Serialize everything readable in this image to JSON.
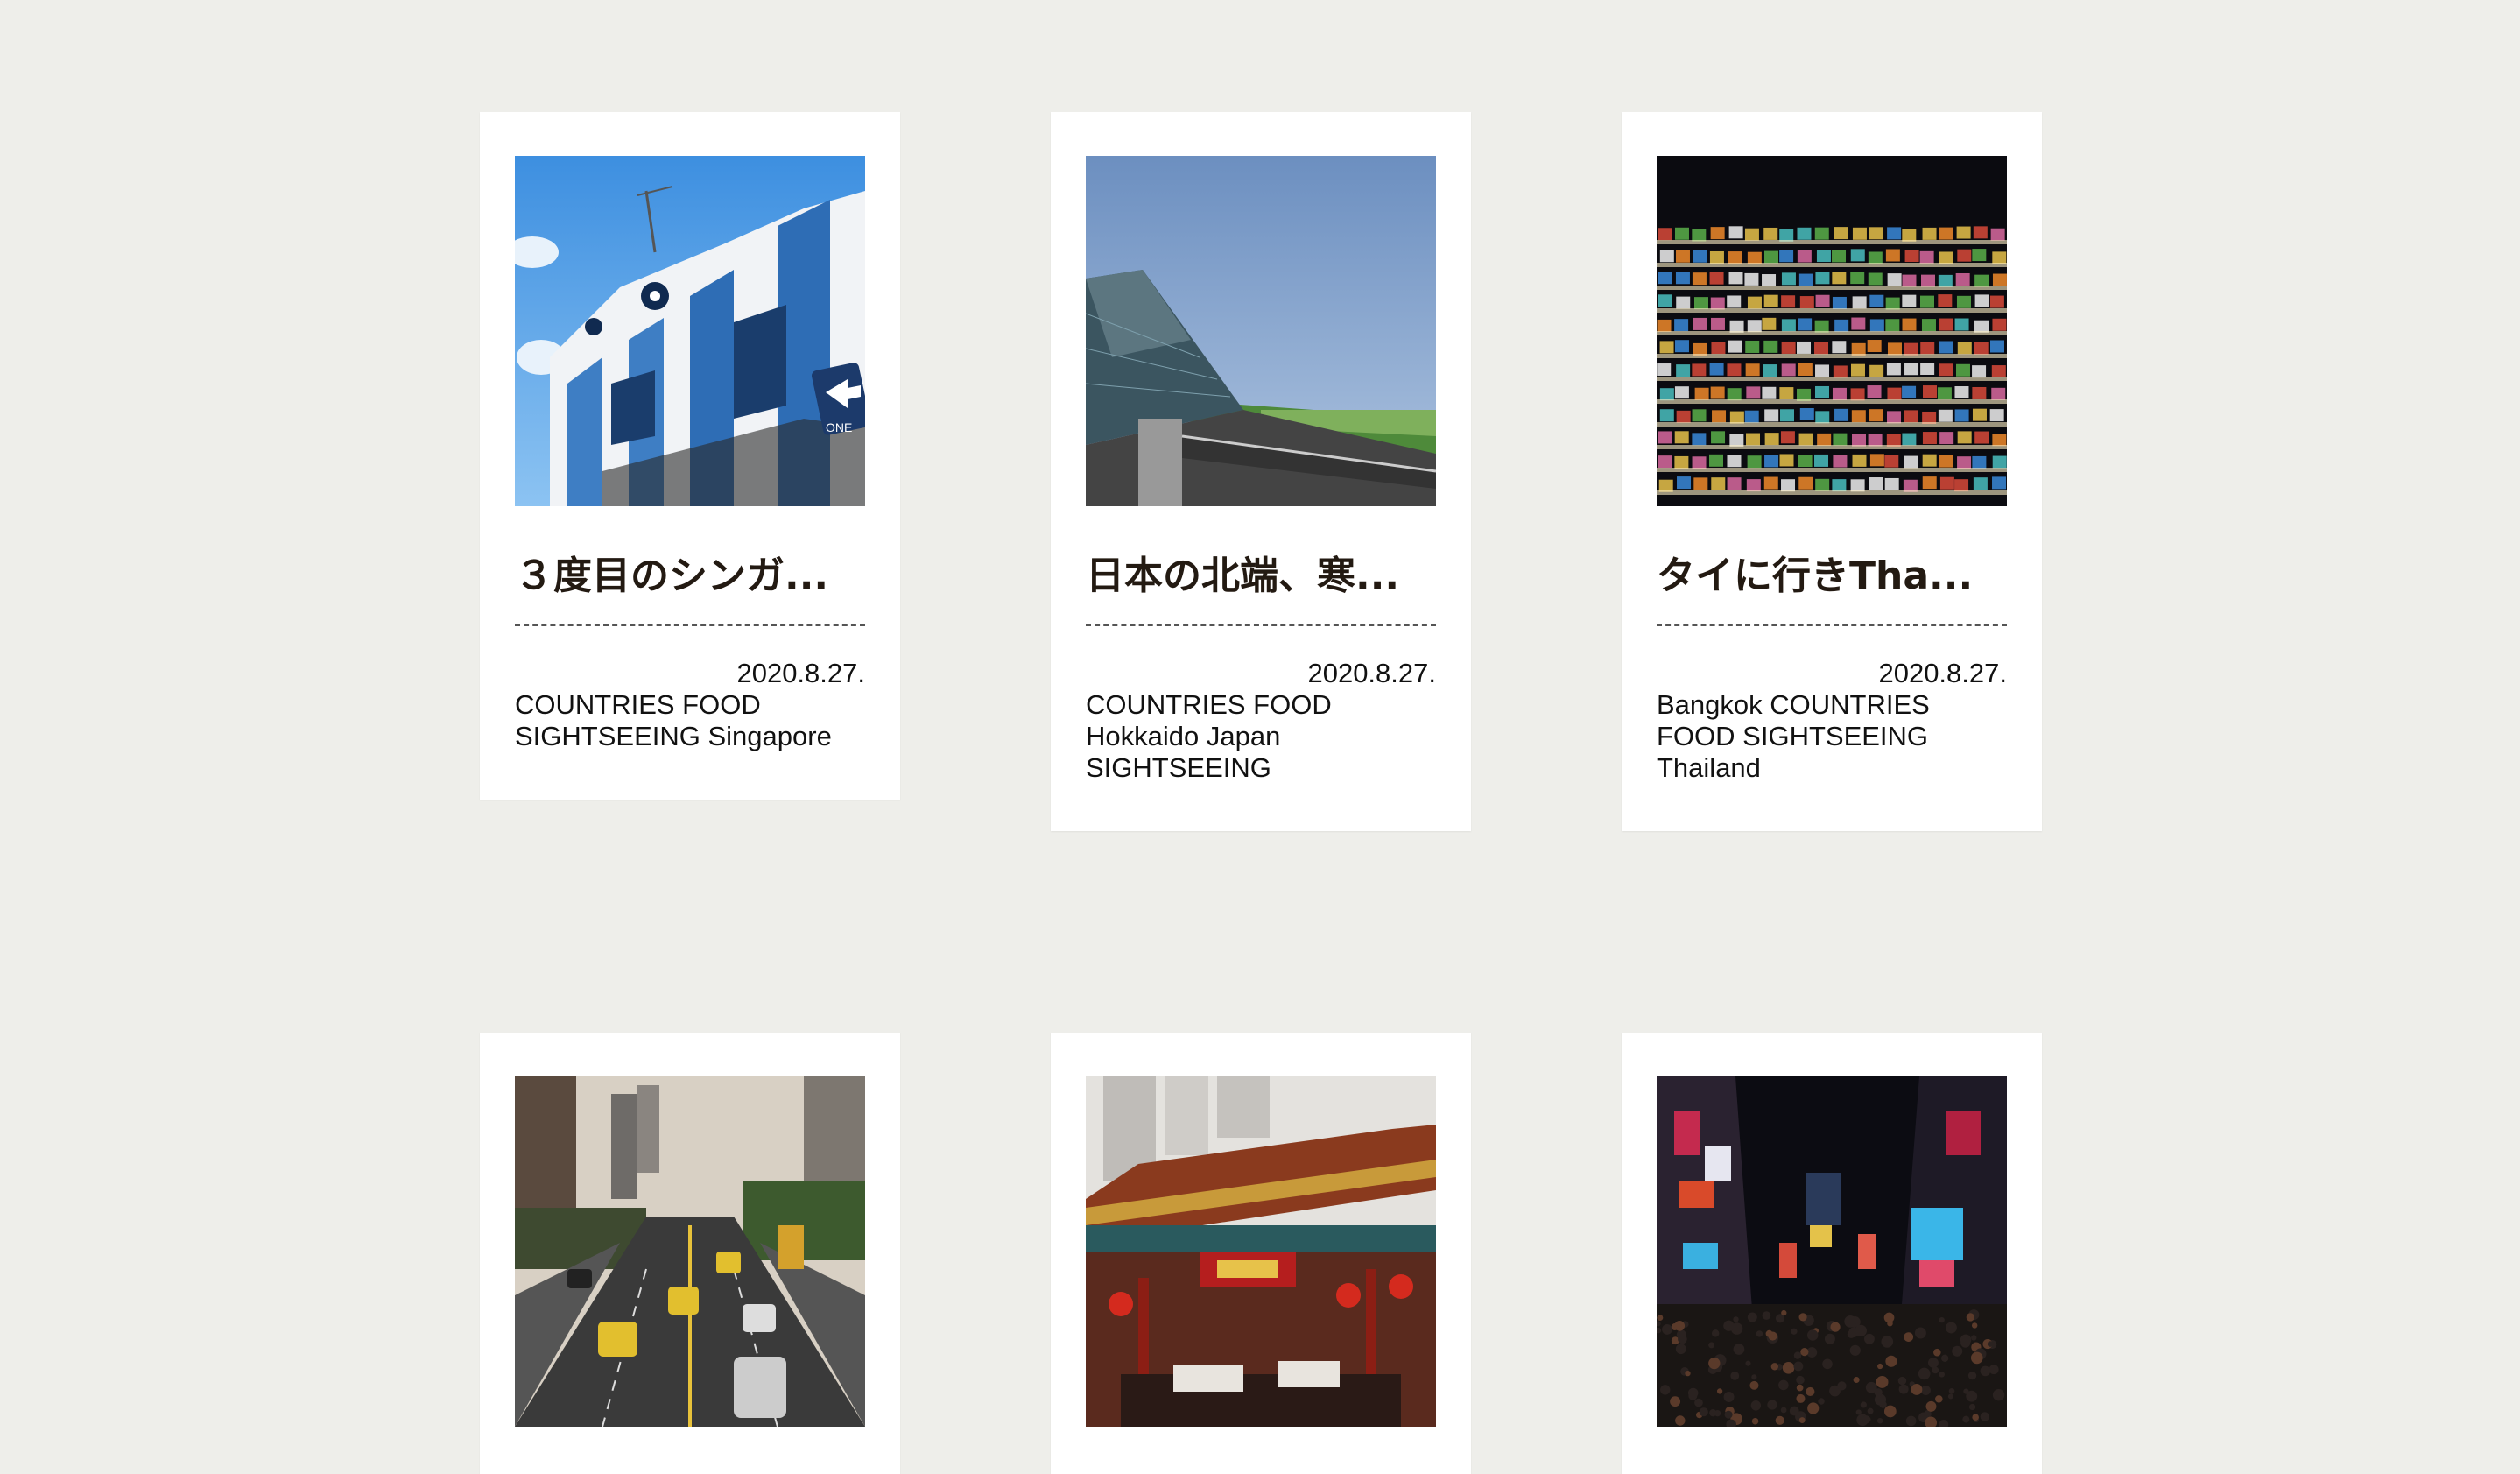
{
  "cards": [
    {
      "image": "singapore-blue-shophouse-photo",
      "title": "３度目のシンガ...",
      "date": "2020.8.27.",
      "tags": "COUNTRIES FOOD SIGHTSEEING Singapore",
      "sign_text": "ONE"
    },
    {
      "image": "hokkaido-glass-pyramid-photo",
      "title": "日本の北端、寒...",
      "date": "2020.8.27.",
      "tags": "COUNTRIES FOOD Hokkaido Japan SIGHTSEEING"
    },
    {
      "image": "bangkok-night-market-photo",
      "title": "タイに行きTha...",
      "date": "2020.8.27.",
      "tags": "Bangkok COUNTRIES FOOD SIGHTSEEING Thailand"
    },
    {
      "image": "taipei-street-traffic-photo"
    },
    {
      "image": "hong-kong-temple-photo"
    },
    {
      "image": "times-square-night-photo"
    }
  ]
}
